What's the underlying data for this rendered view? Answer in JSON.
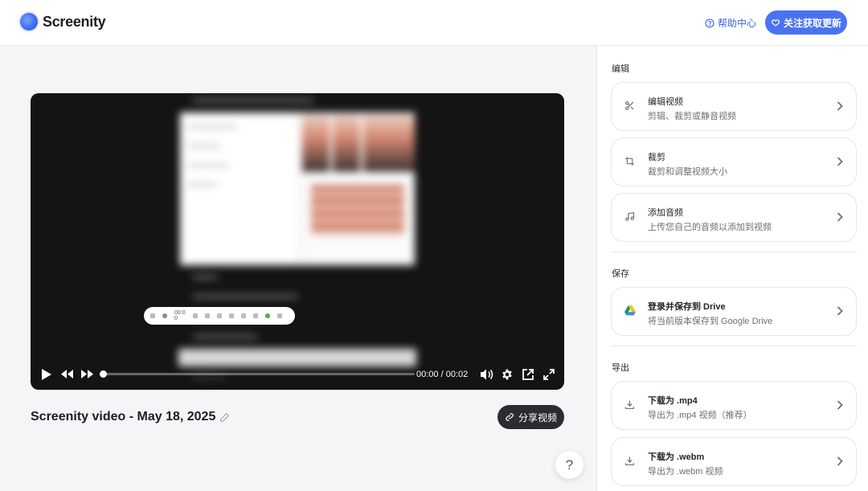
{
  "header": {
    "brand": "Screenity",
    "help_label": "帮助中心",
    "follow_label": "关注获取更新"
  },
  "player": {
    "current_time": "00:00",
    "separator": "/",
    "duration": "00:02",
    "progress": 0,
    "recorder_timer": "00:0 0",
    "blurred_caption": "前往GitHub"
  },
  "video": {
    "title": "Screenity video - May 18, 2025",
    "share_label": "分享视频",
    "fab_help": "?"
  },
  "panel": {
    "edit_section": "编辑",
    "save_section": "保存",
    "export_section": "导出",
    "cards": [
      {
        "icon": "scissors-icon",
        "title": "编辑视频",
        "subtitle": "剪辑、裁剪或静音视频"
      },
      {
        "icon": "crop-icon",
        "title": "裁剪",
        "subtitle": "裁剪和调整视频大小"
      },
      {
        "icon": "music-note-icon",
        "title": "添加音频",
        "subtitle": "上传您自己的音频以添加到视频"
      },
      {
        "icon": "google-drive-icon",
        "title": "登录并保存到 Drive",
        "subtitle": "将当前版本保存到 Google Drive"
      },
      {
        "icon": "download-icon",
        "title": "下载为 .mp4",
        "subtitle": "导出为 .mp4 视频（推荐）"
      },
      {
        "icon": "download-icon",
        "title": "下载为 .webm",
        "subtitle": "导出为 .webm 视频"
      }
    ]
  },
  "colors": {
    "accent": "#4a73f0",
    "share_button": "#2a2c31",
    "player_bg": "#141414"
  }
}
